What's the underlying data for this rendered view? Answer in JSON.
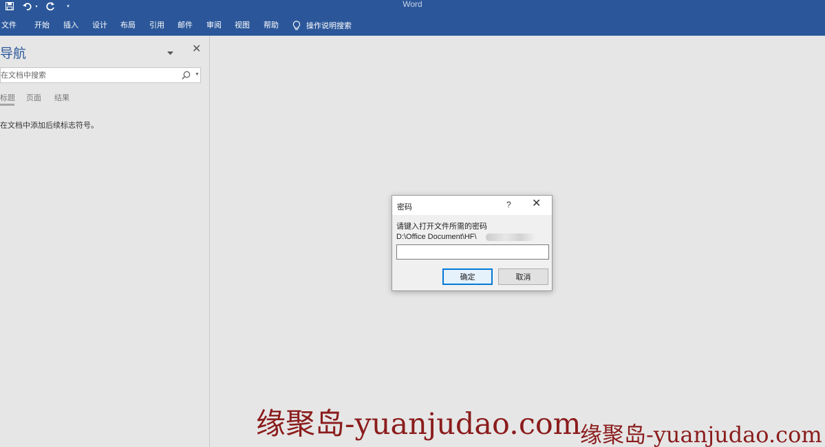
{
  "app": {
    "title": "Word"
  },
  "quick_access": {
    "icons": [
      "save-icon",
      "undo-icon",
      "redo-icon",
      "customize-dropdown-icon"
    ]
  },
  "ribbon": {
    "tabs": [
      "文件",
      "开始",
      "插入",
      "设计",
      "布局",
      "引用",
      "邮件",
      "审阅",
      "视图",
      "帮助"
    ],
    "tell_me": "操作说明搜索"
  },
  "nav_pane": {
    "title": "导航",
    "search_placeholder": "在文档中搜索",
    "tabs": [
      "标题",
      "页面",
      "结果"
    ],
    "hint": "在文档中添加后续标志符号。"
  },
  "dialog": {
    "title": "密码",
    "help": "?",
    "prompt": "请键入打开文件所需的密码",
    "path": "D:\\Office Document\\HF\\",
    "password_value": "",
    "ok_label": "确定",
    "cancel_label": "取消"
  },
  "watermarks": [
    "缘聚岛-yuanjudao.com",
    "缘聚岛-yuanjudao.com"
  ],
  "colors": {
    "ribbon_bg": "#2b579a",
    "workspace_bg": "#e6e6e6",
    "watermark": "#8b1c1c",
    "default_button_border": "#0078d7"
  }
}
